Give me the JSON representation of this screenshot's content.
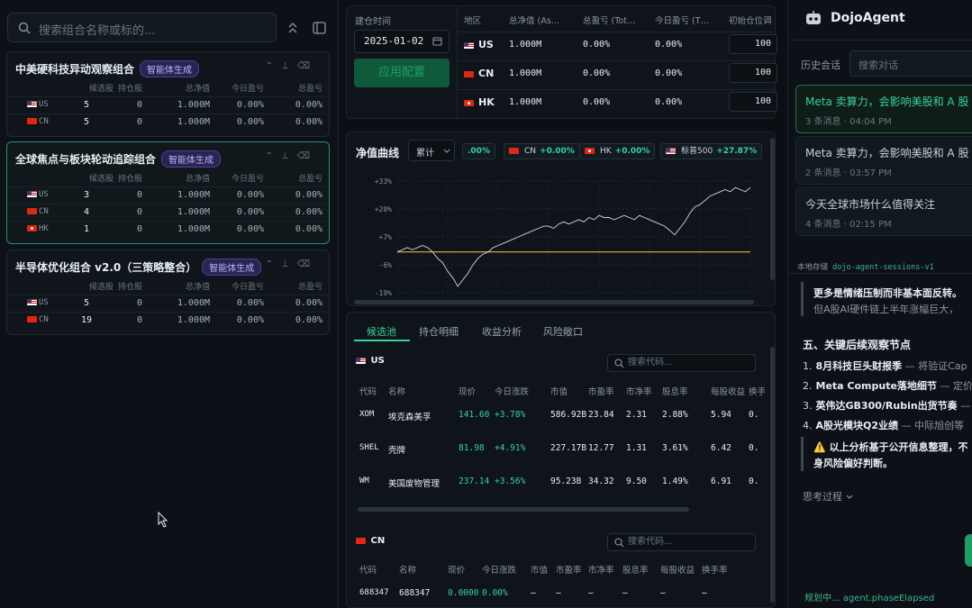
{
  "left": {
    "search_placeholder": "搜索组合名称或标的...",
    "headers": {
      "candidate": "候选股",
      "holding": "持仓股",
      "nav": "总净值",
      "today": "今日盈亏",
      "total": "总盈亏"
    },
    "portfolios": [
      {
        "title": "中美硬科技异动观察组合",
        "badge": "智能体生成",
        "rows": [
          {
            "flag": "us",
            "region": "US",
            "candidate": "5",
            "holding": "0",
            "nav": "1.000M",
            "today": "0.00%",
            "total": "0.00%"
          },
          {
            "flag": "cn",
            "region": "CN",
            "candidate": "5",
            "holding": "0",
            "nav": "1.000M",
            "today": "0.00%",
            "total": "0.00%"
          }
        ]
      },
      {
        "title": "全球焦点与板块轮动追踪组合",
        "badge": "智能体生成",
        "rows": [
          {
            "flag": "us",
            "region": "US",
            "candidate": "3",
            "holding": "0",
            "nav": "1.000M",
            "today": "0.00%",
            "total": "0.00%"
          },
          {
            "flag": "cn",
            "region": "CN",
            "candidate": "4",
            "holding": "0",
            "nav": "1.000M",
            "today": "0.00%",
            "total": "0.00%"
          },
          {
            "flag": "hk",
            "region": "HK",
            "candidate": "1",
            "holding": "0",
            "nav": "1.000M",
            "today": "0.00%",
            "total": "0.00%"
          }
        ]
      },
      {
        "title": "半导体优化组合 v2.0（三策略整合）",
        "badge": "智能体生成",
        "rows": [
          {
            "flag": "us",
            "region": "US",
            "candidate": "5",
            "holding": "0",
            "nav": "1.000M",
            "today": "0.00%",
            "total": "0.00%"
          },
          {
            "flag": "cn",
            "region": "CN",
            "candidate": "19",
            "holding": "0",
            "nav": "1.000M",
            "today": "0.00%",
            "total": "0.00%"
          }
        ]
      }
    ]
  },
  "config": {
    "time_label": "建仓时间",
    "date": "2025-01-02",
    "apply_button": "应用配置",
    "headers": {
      "region": "地区",
      "nav": "总净值 (As…",
      "total": "总盈亏 (Tot…",
      "today": "今日盈亏 (T…",
      "init": "初始仓位调"
    },
    "rows": [
      {
        "flag": "us",
        "region": "US",
        "nav": "1.000M",
        "total": "0.00%",
        "today": "0.00%",
        "init": "100"
      },
      {
        "flag": "cn",
        "region": "CN",
        "nav": "1.000M",
        "total": "0.00%",
        "today": "0.00%",
        "init": "100"
      },
      {
        "flag": "hk",
        "region": "HK",
        "nav": "1.000M",
        "total": "0.00%",
        "today": "0.00%",
        "init": "100"
      }
    ]
  },
  "chart": {
    "title": "净值曲线",
    "mode": "累计",
    "pills": [
      {
        "flag": "",
        "label": "",
        "value": ".00%"
      },
      {
        "flag": "cn",
        "label": "CN",
        "value": "+0.00%"
      },
      {
        "flag": "hk",
        "label": "HK",
        "value": "+0.00%"
      },
      {
        "flag": "us",
        "label": "标普500",
        "value": "+27.87%"
      }
    ]
  },
  "chart_data": {
    "type": "line",
    "title": "净值曲线",
    "xlabel": "",
    "ylabel": "",
    "ylim": [
      -19,
      33
    ],
    "yticks": [
      "+33%",
      "+20%",
      "+7%",
      "-6%",
      "-19%"
    ],
    "grid": true,
    "series": [
      {
        "name": "标普500",
        "color": "#cfd6dd",
        "values": [
          0,
          1,
          2,
          1,
          2,
          3,
          2,
          0,
          -3,
          -5,
          -9,
          -12,
          -16,
          -13,
          -10,
          -6,
          -3,
          -1,
          0,
          2,
          3,
          4,
          5,
          6,
          7,
          8,
          9,
          10,
          11,
          12,
          12,
          11,
          13,
          14,
          13,
          14,
          15,
          14,
          16,
          15,
          17,
          16,
          16,
          15,
          16,
          17,
          16,
          15,
          17,
          16,
          15,
          14,
          13,
          12,
          10,
          8,
          11,
          14,
          18,
          21,
          22,
          24,
          26,
          27,
          28,
          29,
          28,
          30,
          29,
          28,
          30
        ]
      },
      {
        "name": "",
        "color": "#e0b44a",
        "values": [
          0,
          0,
          0,
          0,
          0,
          0,
          0,
          0,
          0,
          0,
          0,
          0,
          0,
          0,
          0,
          0,
          0,
          0,
          0,
          0,
          0,
          0,
          0,
          0,
          0,
          0,
          0,
          0,
          0,
          0,
          0,
          0,
          0,
          0,
          0,
          0,
          0,
          0,
          0,
          0,
          0,
          0,
          0,
          0,
          0,
          0,
          0,
          0,
          0,
          0,
          0,
          0,
          0,
          0,
          0,
          0,
          0,
          0,
          0,
          0,
          0,
          0,
          0,
          0,
          0,
          0,
          0,
          0,
          0,
          0,
          0
        ]
      }
    ]
  },
  "detail": {
    "tabs": [
      "候选池",
      "持仓明细",
      "收益分析",
      "风险敞口"
    ],
    "search_placeholder": "搜索代码...",
    "us": {
      "label": "US",
      "headers": [
        "代码",
        "名称",
        "现价",
        "今日涨跌",
        "市值",
        "市盈率",
        "市净率",
        "股息率",
        "每股收益",
        "换手"
      ],
      "rows": [
        [
          "XOM",
          "埃克森美孚",
          "141.60",
          "+3.78%",
          "586.92B",
          "23.84",
          "2.31",
          "2.88%",
          "5.94",
          "0."
        ],
        [
          "SHEL",
          "壳牌",
          "81.98",
          "+4.91%",
          "227.17B",
          "12.77",
          "1.31",
          "3.61%",
          "6.42",
          "0."
        ],
        [
          "WM",
          "美国废物管理",
          "237.14",
          "+3.56%",
          "95.23B",
          "34.32",
          "9.50",
          "1.49%",
          "6.91",
          "0."
        ]
      ]
    },
    "cn": {
      "label": "CN",
      "headers": [
        "代码",
        "名称",
        "现价",
        "今日涨跌",
        "市值",
        "市盈率",
        "市净率",
        "股息率",
        "每股收益",
        "换手率"
      ],
      "rows": [
        [
          "688347",
          "688347",
          "0.0000",
          "0.00%",
          "—",
          "—",
          "—",
          "—",
          "—",
          "—"
        ]
      ]
    }
  },
  "agent": {
    "name": "DojoAgent",
    "history_label": "历史会话",
    "search_placeholder": "搜索对话",
    "sessions": [
      {
        "title": "Meta 卖算力，会影响美股和 A 股",
        "meta": "3 条消息 · 04:04 PM"
      },
      {
        "title": "Meta 卖算力，会影响美股和 A 股",
        "meta": "2 条消息 · 03:57 PM"
      },
      {
        "title": "今天全球市场什么值得关注",
        "meta": "4 条消息 · 02:15 PM"
      }
    ],
    "storage_label": "本地存储",
    "storage_key": "dojo-agent-sessions-v1",
    "quote_line1": "更多是情绪压制而非基本面反转。",
    "quote_line2": "但A股AI硬件链上半年涨幅巨大，",
    "section_title": "五、关键后续观察节点",
    "items": [
      {
        "n": "1.",
        "bold": "8月科技巨头财报季",
        "rest": " — 将验证Cap"
      },
      {
        "n": "2.",
        "bold": "Meta Compute落地细节",
        "rest": " — 定价"
      },
      {
        "n": "3.",
        "bold": "英伟达GB300/Rubin出货节奏",
        "rest": " —"
      },
      {
        "n": "4.",
        "bold": "A股光模块Q2业绩",
        "rest": " — 中际旭创等"
      }
    ],
    "warn_line1": "⚠️ 以上分析基于公开信息整理，不",
    "warn_line2": "身风险偏好判断。",
    "thinking": "思考过程",
    "status": "规划中... agent.phaseElapsed"
  }
}
